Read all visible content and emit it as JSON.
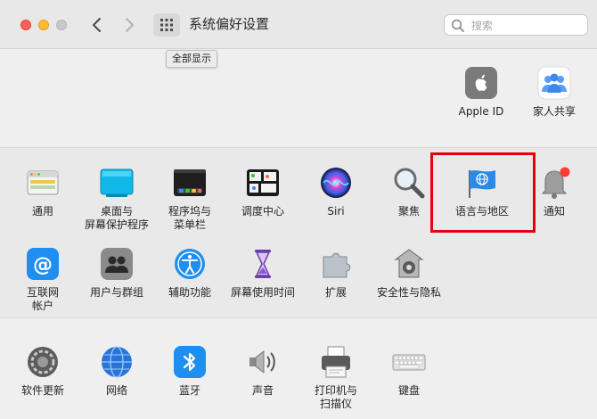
{
  "window": {
    "title": "系统偏好设置",
    "tooltip": "全部显示"
  },
  "search": {
    "placeholder": "搜索",
    "value": ""
  },
  "account": {
    "apple_id": "Apple ID",
    "family": "家人共享"
  },
  "row1": [
    {
      "label": "通用",
      "icon": "general-icon"
    },
    {
      "label": "桌面与\n屏幕保护程序",
      "icon": "desktop-screensaver-icon"
    },
    {
      "label": "程序坞与\n菜单栏",
      "icon": "dock-menubar-icon"
    },
    {
      "label": "调度中心",
      "icon": "mission-control-icon"
    },
    {
      "label": "Siri",
      "icon": "siri-icon"
    },
    {
      "label": "聚焦",
      "icon": "spotlight-icon"
    },
    {
      "label": "语言与地区",
      "icon": "language-region-icon"
    },
    {
      "label": "通知",
      "icon": "notifications-icon"
    }
  ],
  "row2": [
    {
      "label": "互联网\n帐户",
      "icon": "internet-accounts-icon"
    },
    {
      "label": "用户与群组",
      "icon": "users-groups-icon"
    },
    {
      "label": "辅助功能",
      "icon": "accessibility-icon"
    },
    {
      "label": "屏幕使用时间",
      "icon": "screen-time-icon"
    },
    {
      "label": "扩展",
      "icon": "extensions-icon"
    },
    {
      "label": "安全性与隐私",
      "icon": "security-privacy-icon"
    }
  ],
  "row3": [
    {
      "label": "软件更新",
      "icon": "software-update-icon"
    },
    {
      "label": "网络",
      "icon": "network-icon"
    },
    {
      "label": "蓝牙",
      "icon": "bluetooth-icon"
    },
    {
      "label": "声音",
      "icon": "sound-icon"
    },
    {
      "label": "打印机与\n扫描仪",
      "icon": "printers-scanners-icon"
    },
    {
      "label": "键盘",
      "icon": "keyboard-icon"
    }
  ],
  "colors": {
    "highlight": "#e4000f",
    "accent": "#1d6fe0"
  }
}
